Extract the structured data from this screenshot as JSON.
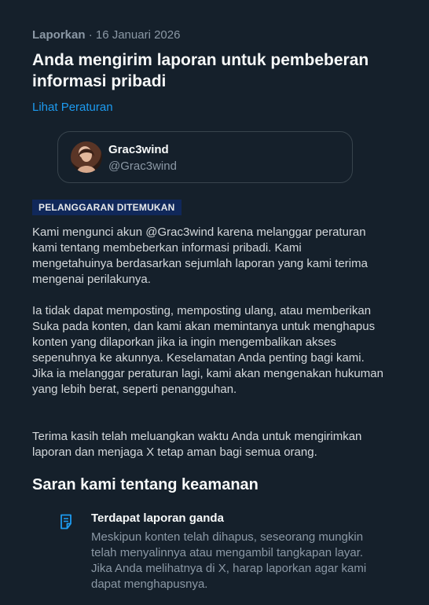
{
  "header": {
    "source": "Laporkan",
    "separator": "·",
    "date": "16 Januari 2026",
    "title": "Anda mengirim laporan untuk pembeberan informasi pribadi",
    "rules_link": "Lihat Peraturan"
  },
  "reported_account": {
    "display_name": "Grac3wind",
    "handle": "@Grac3wind",
    "avatar_icon": "profile-photo"
  },
  "status_badge": "PELANGGARAN DITEMUKAN",
  "paragraphs": [
    "Kami mengunci akun @Grac3wind karena melanggar peraturan kami tentang membeberkan informasi pribadi. Kami mengetahuinya berdasarkan sejumlah laporan yang kami terima mengenai perilakunya.",
    "Ia tidak dapat memposting, memposting ulang, atau memberikan Suka pada konten, dan kami akan memintanya untuk menghapus konten yang dilaporkan jika ia ingin mengembalikan akses sepenuhnya ke akunnya. Keselamatan Anda penting bagi kami. Jika ia melanggar peraturan lagi, kami akan mengenakan hukuman yang lebih berat, seperti penangguhan.",
    "Terima kasih telah meluangkan waktu Anda untuk mengirimkan laporan dan menjaga X tetap aman bagi semua orang."
  ],
  "safety": {
    "heading": "Saran kami tentang keamanan",
    "tips": [
      {
        "icon": "document-icon",
        "title": "Terdapat laporan ganda",
        "body": "Meskipun konten telah dihapus, seseorang mungkin telah menyalinnya atau mengambil tangkapan layar. Jika Anda melihatnya di X, harap laporkan agar kami dapat menghapusnya."
      }
    ]
  },
  "colors": {
    "background": "#15202b",
    "accent": "#1d9bf0",
    "badge_bg": "#10285a"
  }
}
